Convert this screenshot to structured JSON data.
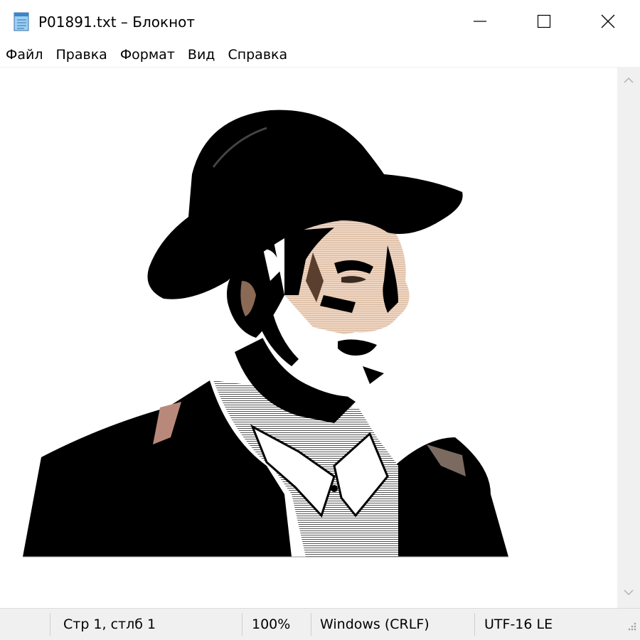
{
  "window": {
    "title": "P01891.txt – Блокнот",
    "icon": "notepad-icon"
  },
  "menu": {
    "items": [
      "Файл",
      "Правка",
      "Формат",
      "Вид",
      "Справка"
    ]
  },
  "editor": {
    "content_description": "ascii-art-portrait"
  },
  "status": {
    "position": "Стр 1, стлб 1",
    "zoom": "100%",
    "line_endings": "Windows (CRLF)",
    "encoding": "UTF-16 LE"
  },
  "colors": {
    "ink": "#000000",
    "skin": "#e8cbb4",
    "beard": "#ffffff",
    "shirt": "#d8d8d8",
    "chrome": "#f0f0f0"
  }
}
